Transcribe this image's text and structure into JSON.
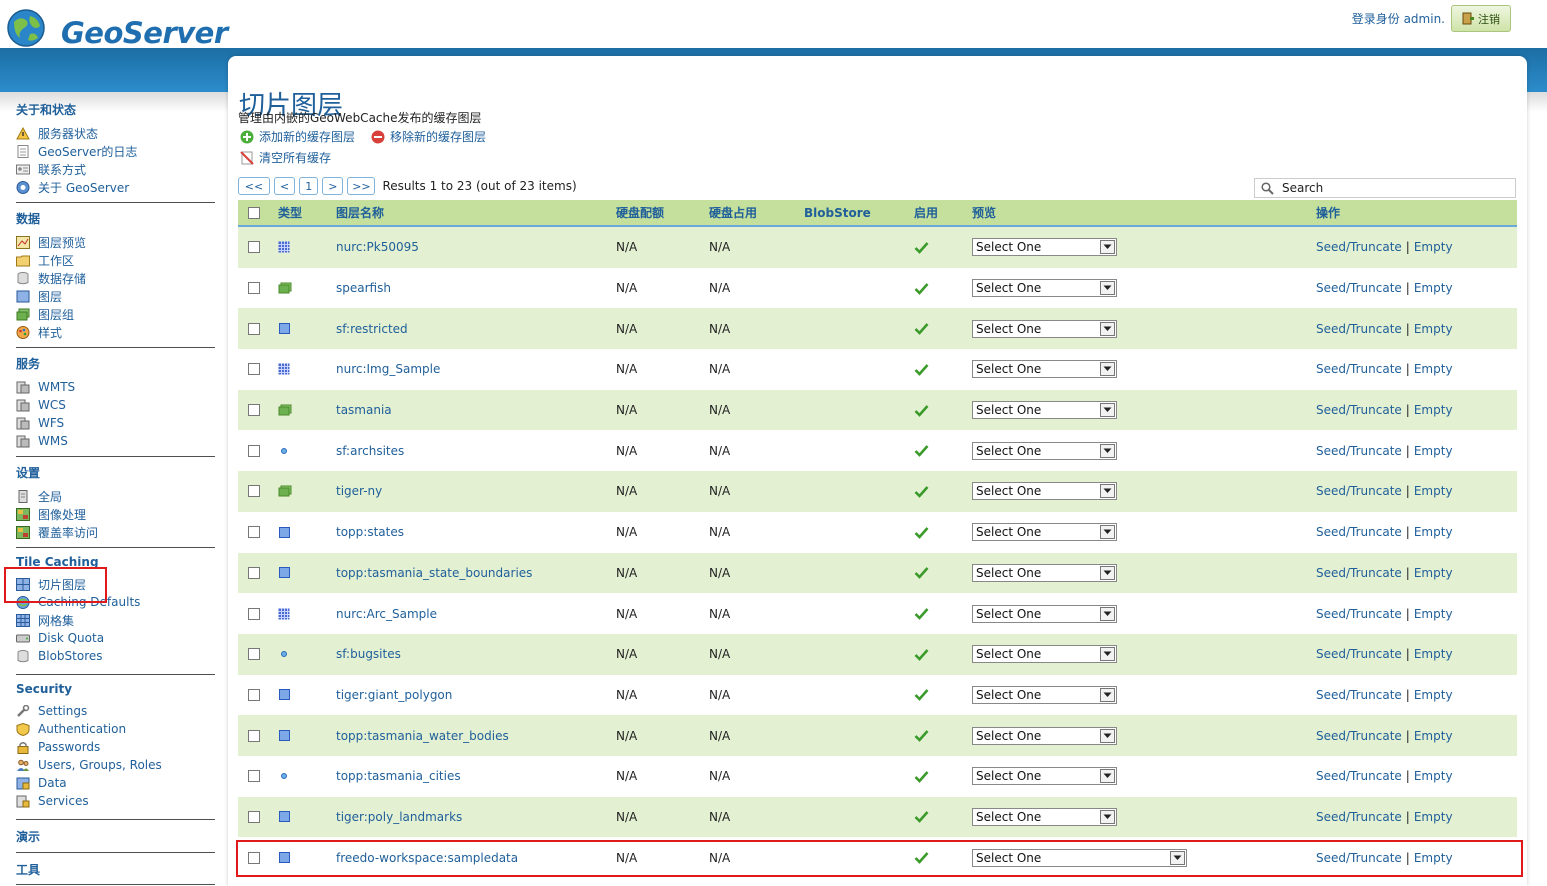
{
  "header": {
    "brand": "GeoServer",
    "login_text": "登录身份 admin.",
    "logout_label": "注销"
  },
  "sidebar": {
    "sections": [
      {
        "title": "关于和状态",
        "items": [
          {
            "label": "服务器状态",
            "icon": "server-status-icon"
          },
          {
            "label": "GeoServer的日志",
            "icon": "log-icon"
          },
          {
            "label": "联系方式",
            "icon": "contact-icon"
          },
          {
            "label": "关于 GeoServer",
            "icon": "about-icon"
          }
        ]
      },
      {
        "title": "数据",
        "items": [
          {
            "label": "图层预览",
            "icon": "layer-preview-icon"
          },
          {
            "label": "工作区",
            "icon": "workspace-icon"
          },
          {
            "label": "数据存储",
            "icon": "datastore-icon"
          },
          {
            "label": "图层",
            "icon": "layer-icon"
          },
          {
            "label": "图层组",
            "icon": "layergroup-icon"
          },
          {
            "label": "样式",
            "icon": "style-icon"
          }
        ]
      },
      {
        "title": "服务",
        "items": [
          {
            "label": "WMTS",
            "icon": "service-icon"
          },
          {
            "label": "WCS",
            "icon": "service-icon"
          },
          {
            "label": "WFS",
            "icon": "service-icon"
          },
          {
            "label": "WMS",
            "icon": "service-icon"
          }
        ]
      },
      {
        "title": "设置",
        "items": [
          {
            "label": "全局",
            "icon": "global-settings-icon"
          },
          {
            "label": "图像处理",
            "icon": "image-processing-icon"
          },
          {
            "label": "覆盖率访问",
            "icon": "coverage-access-icon"
          }
        ]
      },
      {
        "title": "Tile Caching",
        "items": [
          {
            "label": "切片图层",
            "icon": "tile-layers-icon"
          },
          {
            "label": "Caching Defaults",
            "icon": "caching-defaults-icon"
          },
          {
            "label": "网格集",
            "icon": "gridset-icon"
          },
          {
            "label": "Disk Quota",
            "icon": "disk-quota-icon"
          },
          {
            "label": "BlobStores",
            "icon": "blobstore-icon"
          }
        ]
      },
      {
        "title": "Security",
        "items": [
          {
            "label": "Settings",
            "icon": "security-settings-icon"
          },
          {
            "label": "Authentication",
            "icon": "authentication-icon"
          },
          {
            "label": "Passwords",
            "icon": "passwords-icon"
          },
          {
            "label": "Users, Groups, Roles",
            "icon": "users-icon"
          },
          {
            "label": "Data",
            "icon": "data-security-icon"
          },
          {
            "label": "Services",
            "icon": "services-security-icon"
          }
        ]
      },
      {
        "title": "演示",
        "items": []
      },
      {
        "title": "工具",
        "items": []
      }
    ]
  },
  "main": {
    "title": "切片图层",
    "description": "管理由内嵌的GeoWebCache发布的缓存图层",
    "actions": {
      "add": "添加新的缓存图层",
      "remove": "移除新的缓存图层",
      "clear": "清空所有缓存"
    },
    "pager": {
      "first": "<<",
      "prev": "<",
      "page": "1",
      "next": ">",
      "last": ">>",
      "results": "Results 1 to 23 (out of 23 items)"
    },
    "search_placeholder": "Search",
    "columns": [
      "类型",
      "图层名称",
      "硬盘配额",
      "硬盘占用",
      "BlobStore",
      "启用",
      "预览",
      "操作"
    ],
    "select_default": "Select One",
    "ops": {
      "seed": "Seed/Truncate",
      "sep": "|",
      "empty": "Empty"
    },
    "rows": [
      {
        "name": "nurc:Pk50095",
        "type": "raster",
        "quota": "N/A",
        "usage": "N/A",
        "blobstore": "",
        "enabled": true
      },
      {
        "name": "spearfish",
        "type": "group",
        "quota": "N/A",
        "usage": "N/A",
        "blobstore": "",
        "enabled": true
      },
      {
        "name": "sf:restricted",
        "type": "polygon",
        "quota": "N/A",
        "usage": "N/A",
        "blobstore": "",
        "enabled": true
      },
      {
        "name": "nurc:Img_Sample",
        "type": "raster",
        "quota": "N/A",
        "usage": "N/A",
        "blobstore": "",
        "enabled": true
      },
      {
        "name": "tasmania",
        "type": "group",
        "quota": "N/A",
        "usage": "N/A",
        "blobstore": "",
        "enabled": true
      },
      {
        "name": "sf:archsites",
        "type": "point",
        "quota": "N/A",
        "usage": "N/A",
        "blobstore": "",
        "enabled": true
      },
      {
        "name": "tiger-ny",
        "type": "group",
        "quota": "N/A",
        "usage": "N/A",
        "blobstore": "",
        "enabled": true
      },
      {
        "name": "topp:states",
        "type": "polygon",
        "quota": "N/A",
        "usage": "N/A",
        "blobstore": "",
        "enabled": true
      },
      {
        "name": "topp:tasmania_state_boundaries",
        "type": "polygon",
        "quota": "N/A",
        "usage": "N/A",
        "blobstore": "",
        "enabled": true
      },
      {
        "name": "nurc:Arc_Sample",
        "type": "raster",
        "quota": "N/A",
        "usage": "N/A",
        "blobstore": "",
        "enabled": true
      },
      {
        "name": "sf:bugsites",
        "type": "point",
        "quota": "N/A",
        "usage": "N/A",
        "blobstore": "",
        "enabled": true
      },
      {
        "name": "tiger:giant_polygon",
        "type": "polygon",
        "quota": "N/A",
        "usage": "N/A",
        "blobstore": "",
        "enabled": true
      },
      {
        "name": "topp:tasmania_water_bodies",
        "type": "polygon",
        "quota": "N/A",
        "usage": "N/A",
        "blobstore": "",
        "enabled": true
      },
      {
        "name": "topp:tasmania_cities",
        "type": "point",
        "quota": "N/A",
        "usage": "N/A",
        "blobstore": "",
        "enabled": true
      },
      {
        "name": "tiger:poly_landmarks",
        "type": "polygon",
        "quota": "N/A",
        "usage": "N/A",
        "blobstore": "",
        "enabled": true
      },
      {
        "name": "freedo-workspace:sampledata",
        "type": "polygon",
        "quota": "N/A",
        "usage": "N/A",
        "blobstore": "",
        "enabled": true
      }
    ]
  },
  "colors": {
    "brand_blue": "#1f5f9a",
    "band_blue": "#2c8ccb",
    "row_green": "#e3f0d2",
    "header_green": "#c5e09c",
    "highlight_red": "#e0191b",
    "check_green": "#3a9a2a"
  }
}
